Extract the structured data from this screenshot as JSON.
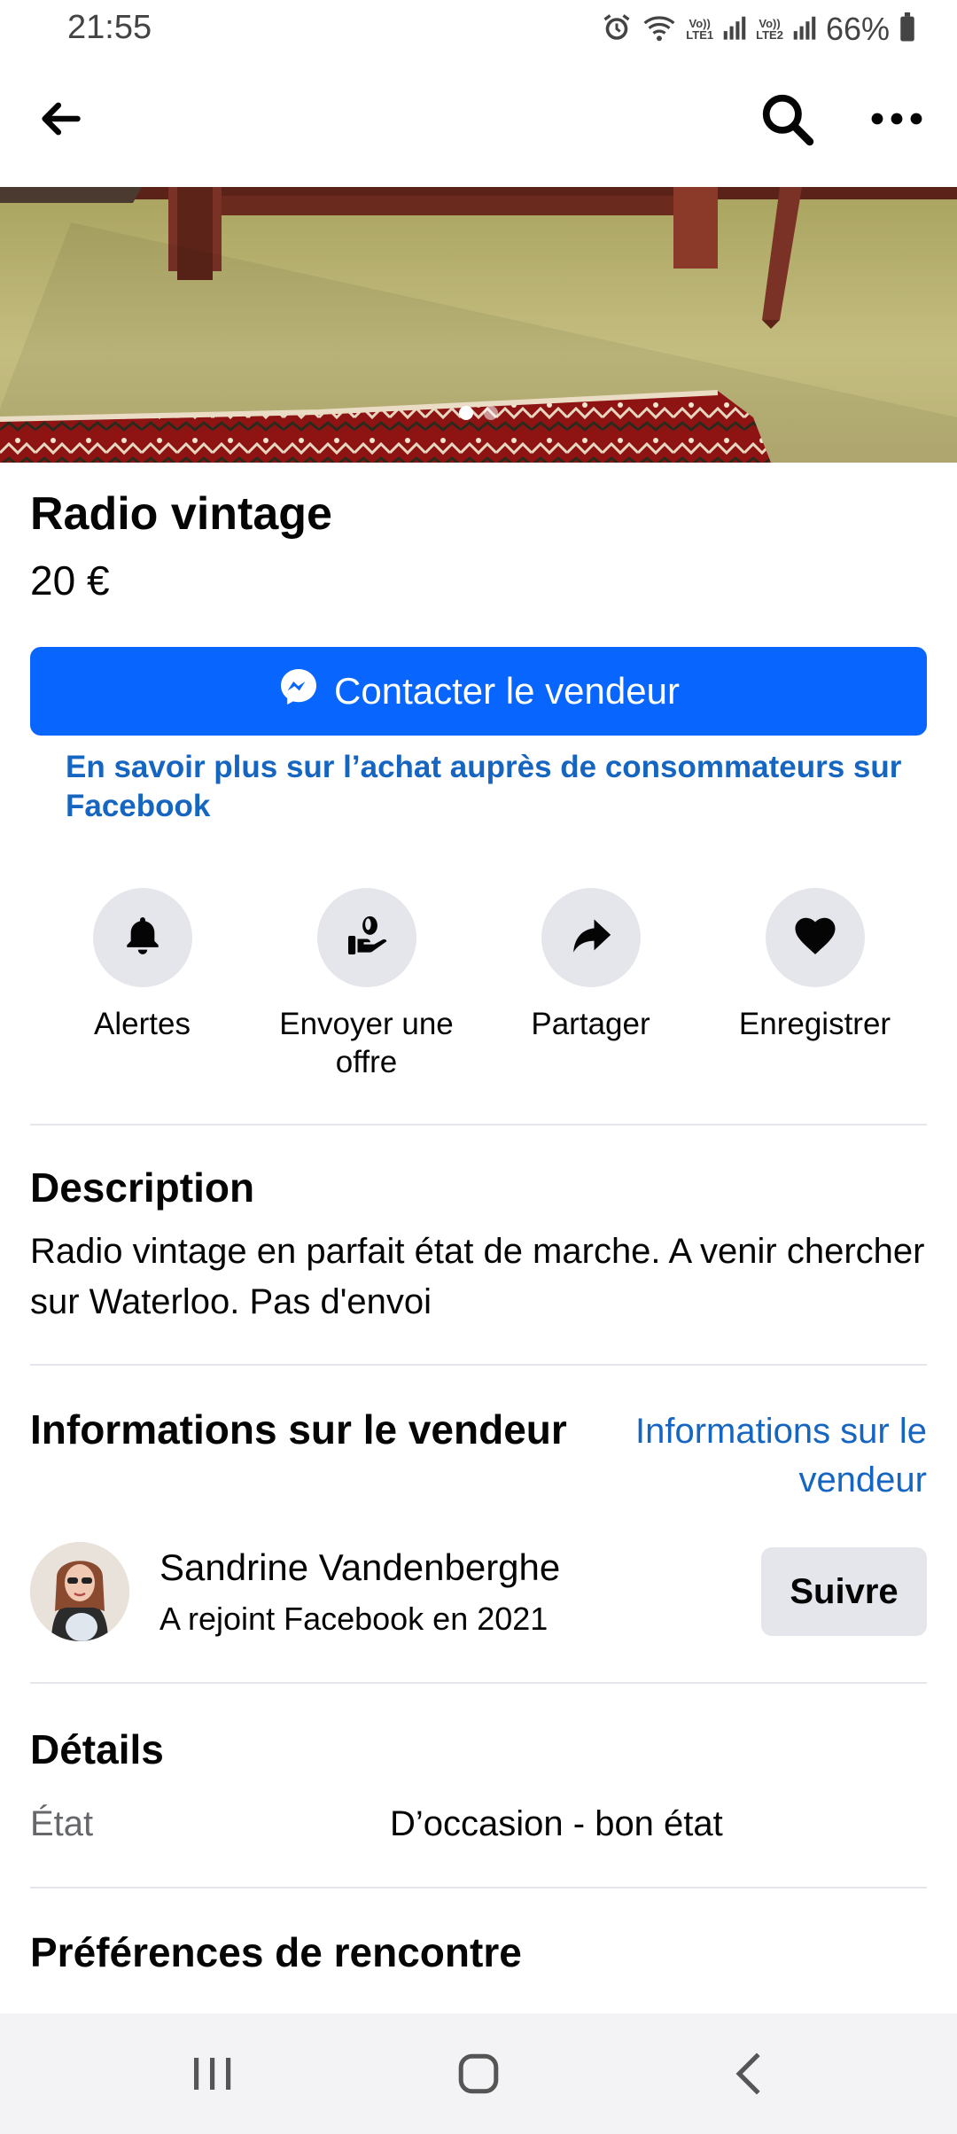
{
  "status_bar": {
    "time": "21:55",
    "battery_percent": "66%",
    "network_labels": [
      "Vo)) LTE1",
      "Vo)) LTE2"
    ],
    "icons": [
      "alarm-icon",
      "wifi-icon",
      "signal-icon",
      "battery-icon"
    ]
  },
  "app_bar": {
    "back_icon": "back-arrow-icon",
    "search_icon": "search-icon",
    "more_icon": "more-icon"
  },
  "photo": {
    "slide_count": 2,
    "active_slide": 1
  },
  "listing": {
    "title": "Radio vintage",
    "price": "20 €"
  },
  "contact_button": {
    "label": "Contacter le vendeur",
    "icon": "messenger-icon"
  },
  "learn_more_link": "En savoir plus sur l’achat auprès de consommateurs sur Facebook",
  "actions": [
    {
      "label": "Alertes",
      "icon": "bell-icon"
    },
    {
      "label": "Envoyer une offre",
      "icon": "offer-hand-icon"
    },
    {
      "label": "Partager",
      "icon": "share-icon"
    },
    {
      "label": "Enregistrer",
      "icon": "heart-icon"
    }
  ],
  "description": {
    "heading": "Description",
    "text": "Radio vintage en parfait état de marche. A venir chercher sur Waterloo. Pas d'envoi"
  },
  "seller": {
    "heading": "Informations sur le vendeur",
    "link": "Informations sur le vendeur",
    "name": "Sandrine Vandenberghe",
    "joined": "A rejoint Facebook en 2021",
    "follow_label": "Suivre"
  },
  "details": {
    "heading": "Détails",
    "condition_label": "État",
    "condition_value": "D’occasion - bon état"
  },
  "meeting": {
    "heading": "Préférences de rencontre"
  },
  "colors": {
    "accent": "#0866ff",
    "link": "#1665c0",
    "button_gray": "#e4e6eb"
  },
  "nav_bar": {
    "icons": [
      "recent-apps-icon",
      "home-icon",
      "back-icon"
    ]
  }
}
